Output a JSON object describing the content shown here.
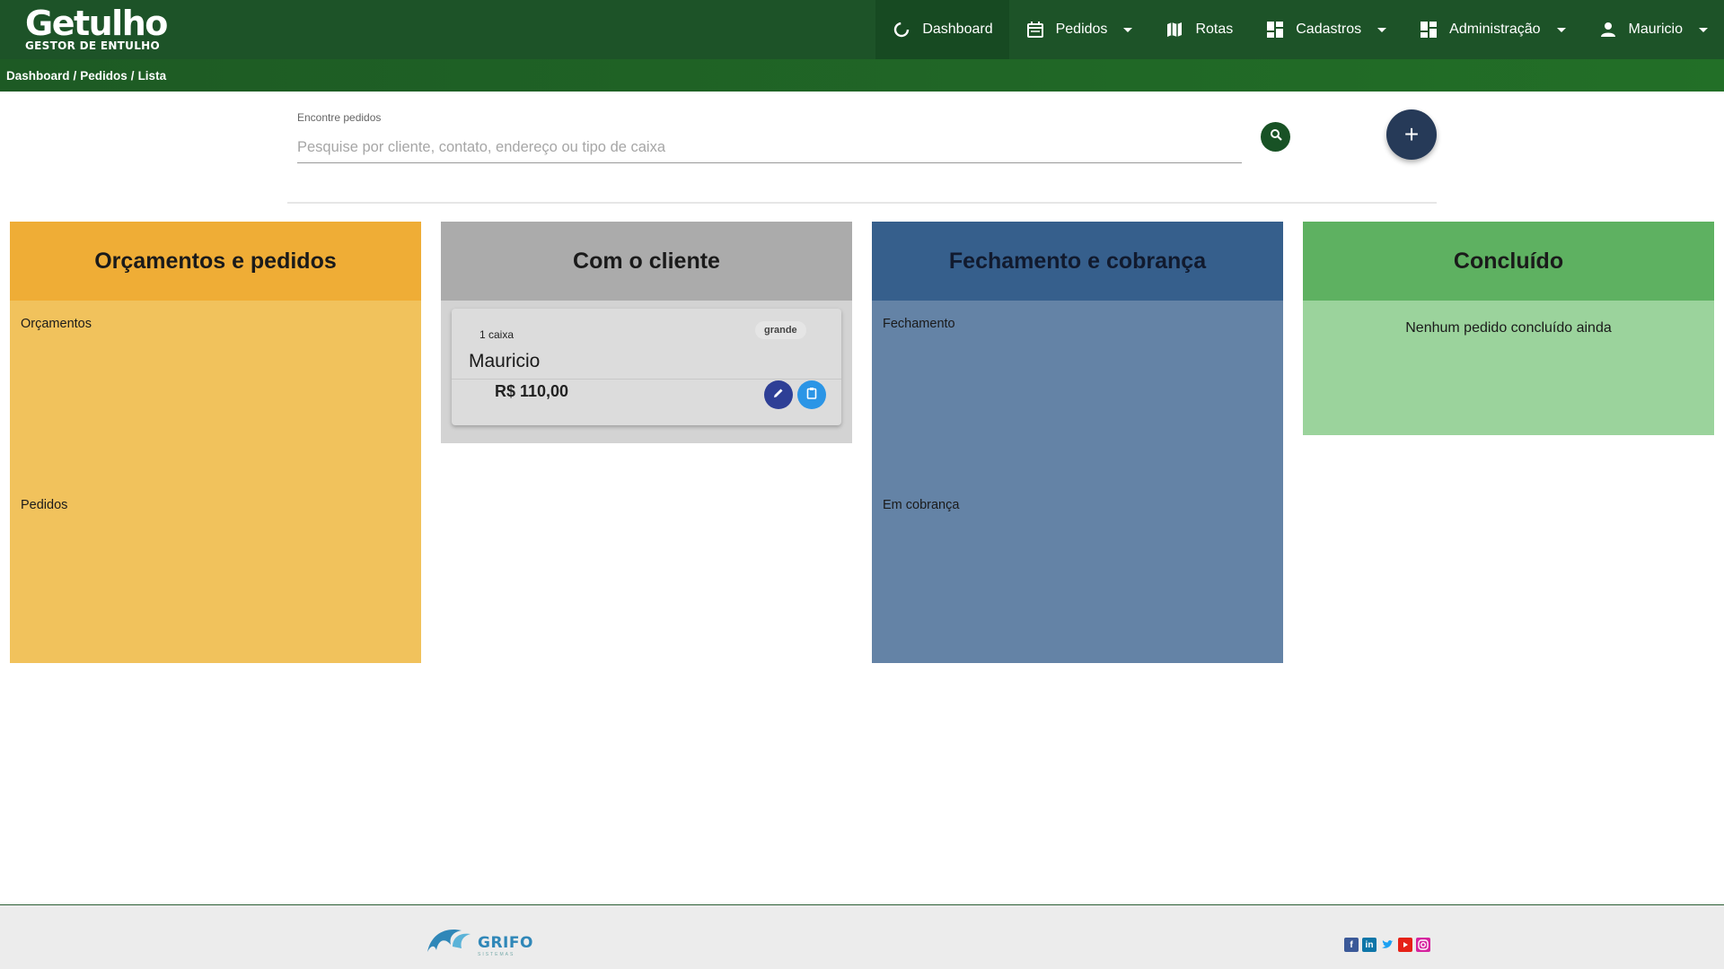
{
  "header": {
    "brand": "Getulho",
    "tagline": "GESTOR DE ENTULHO",
    "nav": [
      {
        "label": "Dashboard",
        "icon": "dashboard-icon"
      },
      {
        "label": "Pedidos",
        "icon": "calendar-icon"
      },
      {
        "label": "Rotas",
        "icon": "map-icon"
      },
      {
        "label": "Cadastros",
        "icon": "grid-icon"
      },
      {
        "label": "Administração",
        "icon": "grid-icon"
      },
      {
        "label": "Mauricio",
        "icon": "user-icon"
      }
    ]
  },
  "breadcrumb": {
    "items": [
      "Dashboard",
      "/",
      "Pedidos",
      "/",
      "Lista"
    ]
  },
  "search": {
    "label": "Encontre pedidos",
    "placeholder": "Pesquise por cliente, contato, endereço ou tipo de caixa",
    "value": "",
    "add_label": "+"
  },
  "columns": [
    {
      "title": "Orçamentos e pedidos",
      "sections": [
        "Orçamentos",
        "Pedidos"
      ],
      "color": "#efad36"
    },
    {
      "title": "Com o cliente",
      "color": "#ababab",
      "cards": [
        {
          "qty": "1 caixa",
          "size": "grande",
          "client": "Mauricio",
          "price": "R$ 110,00"
        }
      ]
    },
    {
      "title": "Fechamento e cobrança",
      "sections": [
        "Fechamento",
        "Em cobrança"
      ],
      "color": "#365f8c"
    },
    {
      "title": "Concluído",
      "empty_message": "Nenhum pedido concluído ainda",
      "color": "#5eb161"
    }
  ],
  "footer": {
    "partner": "GRIFO",
    "partner_tag": "SISTEMAS",
    "social": [
      "facebook-icon",
      "linkedin-icon",
      "twitter-icon",
      "youtube-icon",
      "instagram-icon"
    ]
  },
  "colors": {
    "header_bg": "#1d5328",
    "breadcrumb_bg": "#1d5a24",
    "add_button": "#263a58",
    "edit_button": "#2e3f96",
    "doc_button": "#2b95e6"
  }
}
